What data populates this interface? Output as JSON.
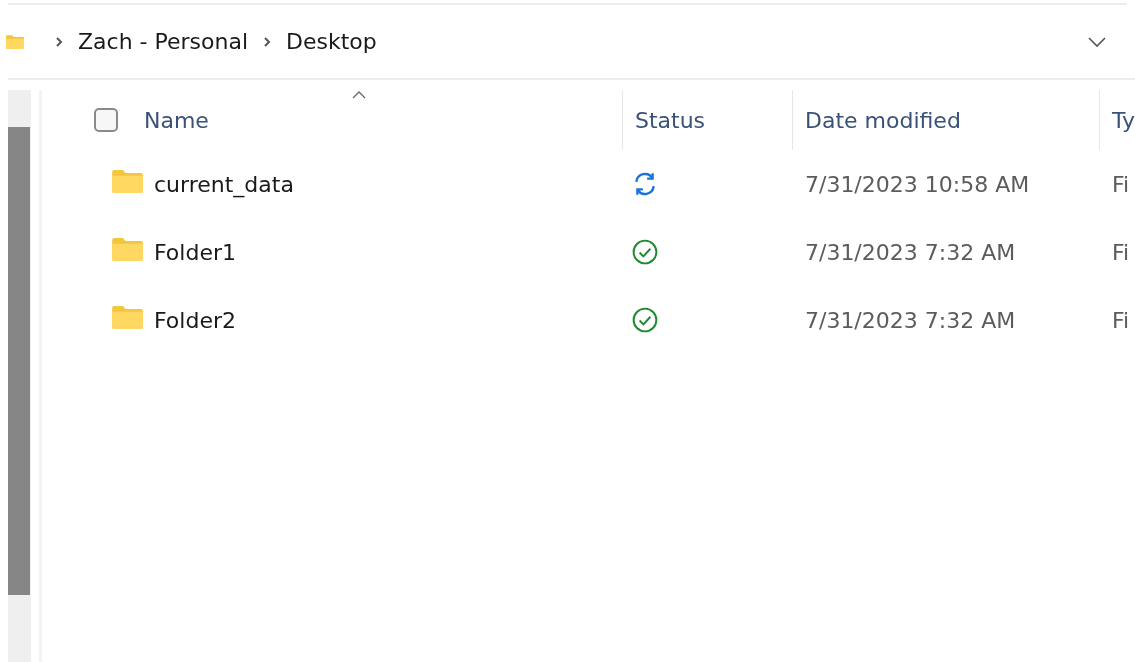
{
  "breadcrumb": [
    {
      "label": "Zach - Personal"
    },
    {
      "label": "Desktop"
    }
  ],
  "table": {
    "select_all": {
      "checked": false
    },
    "columns": [
      {
        "label": "Name",
        "sorted": true
      },
      {
        "label": "Status",
        "sorted": false
      },
      {
        "label": "Date modified",
        "sorted": false
      },
      {
        "label": "Ty",
        "sorted": false
      }
    ],
    "rows": [
      {
        "name": "current_data",
        "status": {
          "kind": "syncing"
        },
        "date_modified": "7/31/2023 10:58 AM",
        "column_4": "Fi"
      },
      {
        "name": "Folder1",
        "status": {
          "kind": "synced"
        },
        "date_modified": "7/31/2023 7:32 AM",
        "column_4": "Fi"
      },
      {
        "name": "Folder2",
        "status": {
          "kind": "synced"
        },
        "date_modified": "7/31/2023 7:32 AM",
        "column_4": "Fi"
      }
    ]
  }
}
